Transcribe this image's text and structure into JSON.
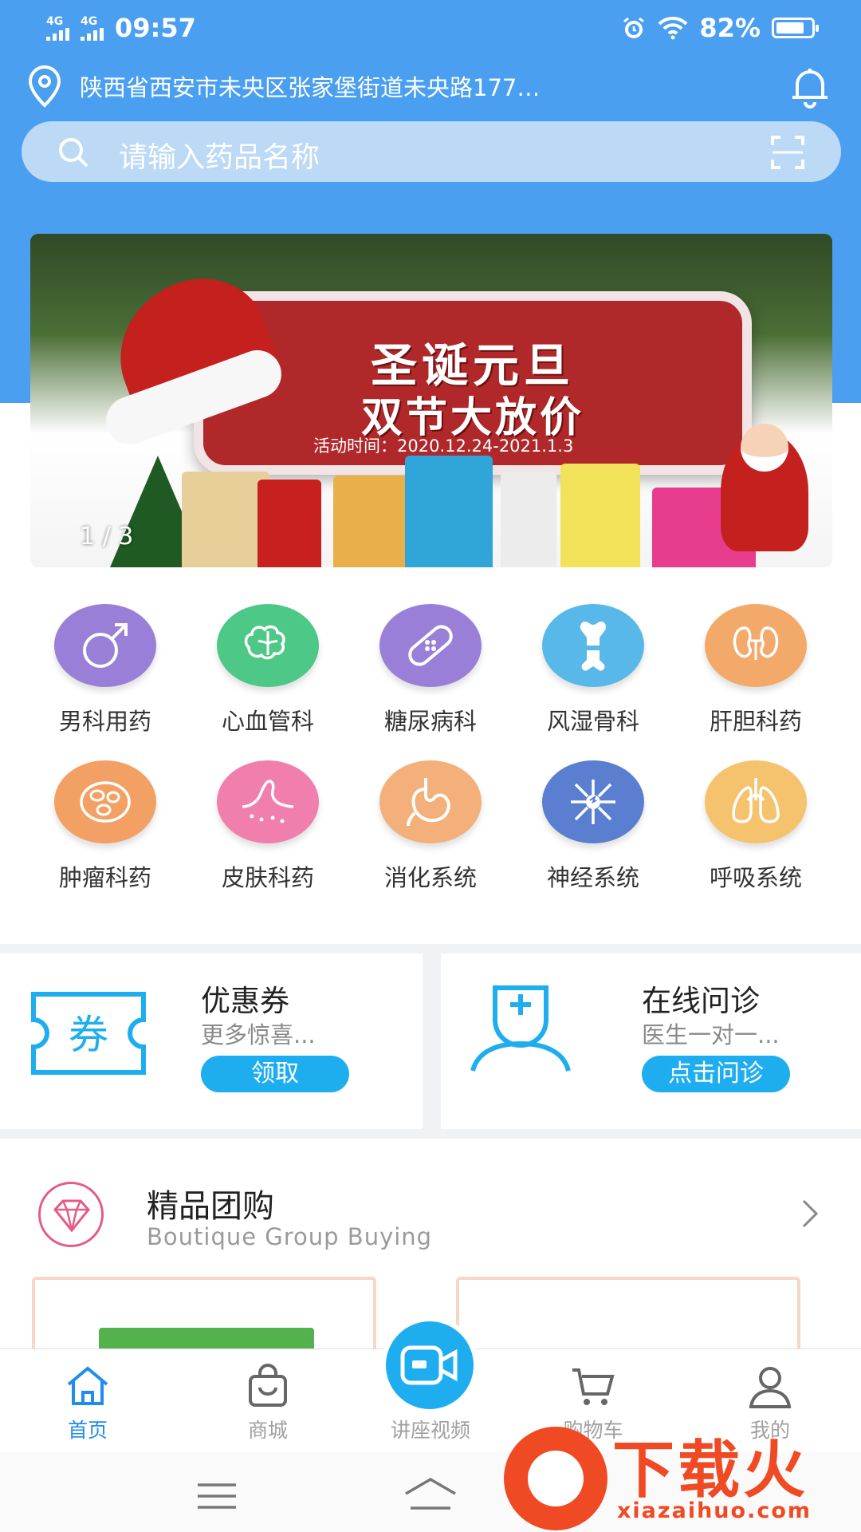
{
  "status_bar": {
    "time": "09:57",
    "network1": "4G",
    "network2": "4G",
    "battery": "82%",
    "battery_level": 0.82
  },
  "header": {
    "address": "陕西省西安市未央区张家堡街道未央路177…"
  },
  "search": {
    "placeholder": "请输入药品名称"
  },
  "banner": {
    "line1": "圣诞元旦",
    "line2": "双节大放价",
    "activity_time": "活动时间：2020.12.24-2021.1.3",
    "indicator": "1 / 3"
  },
  "categories": [
    {
      "label": "男科用药",
      "icon": "male-symbol-icon",
      "color": "#9a7fd8"
    },
    {
      "label": "心血管科",
      "icon": "brain-icon",
      "color": "#4ec887"
    },
    {
      "label": "糖尿病科",
      "icon": "bandage-icon",
      "color": "#9a7fd8"
    },
    {
      "label": "风湿骨科",
      "icon": "bone-joint-icon",
      "color": "#58b8ea"
    },
    {
      "label": "肝胆科药",
      "icon": "kidney-icon",
      "color": "#f3a96a"
    },
    {
      "label": "肿瘤科药",
      "icon": "cells-icon",
      "color": "#f3a064"
    },
    {
      "label": "皮肤科药",
      "icon": "skin-icon",
      "color": "#f07fae"
    },
    {
      "label": "消化系统",
      "icon": "stomach-icon",
      "color": "#f3b07a"
    },
    {
      "label": "神经系统",
      "icon": "neuron-icon",
      "color": "#5a7fd0"
    },
    {
      "label": "呼吸系统",
      "icon": "lungs-icon",
      "color": "#f5c26e"
    }
  ],
  "promos": {
    "coupon": {
      "title": "优惠券",
      "subtitle": "更多惊喜...",
      "button": "领取",
      "icon_text": "券"
    },
    "consult": {
      "title": "在线问诊",
      "subtitle": "医生一对一...",
      "button": "点击问诊"
    }
  },
  "group_buying": {
    "title": "精品团购",
    "subtitle": "Boutique Group Buying"
  },
  "tabbar": {
    "items": [
      {
        "label": "首页",
        "icon": "home-icon",
        "active": true
      },
      {
        "label": "商城",
        "icon": "shopping-bag-icon",
        "active": false
      },
      {
        "label": "讲座视频",
        "icon": "video-camera-icon",
        "active": false
      },
      {
        "label": "购物车",
        "icon": "cart-icon",
        "active": false
      },
      {
        "label": "我的",
        "icon": "profile-icon",
        "active": false
      }
    ]
  },
  "watermark": {
    "text": "下载火",
    "url": "xiazaihuo.com"
  },
  "colors": {
    "primary_blue": "#4a9ff0",
    "accent": "#1eaef0",
    "active_tab": "#1f8cf0"
  }
}
